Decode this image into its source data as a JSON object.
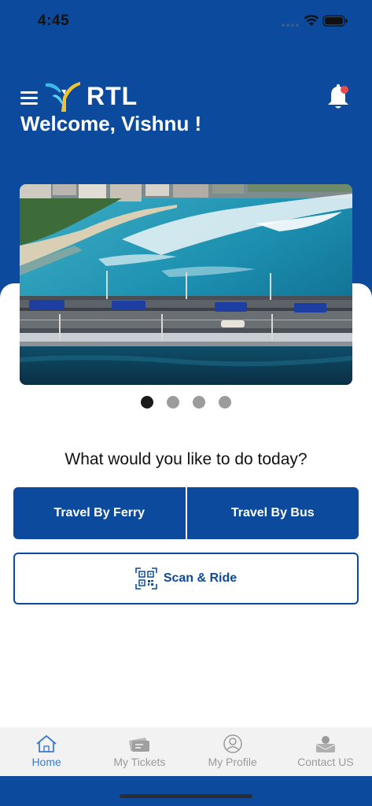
{
  "status_bar": {
    "time": "4:45"
  },
  "header": {
    "brand": "RTL",
    "welcome": "Welcome, Vishnu !"
  },
  "carousel": {
    "page_count": 4,
    "active_index": 0
  },
  "main": {
    "question": "What would you like to do today?",
    "ferry_label": "Travel By Ferry",
    "bus_label": "Travel By Bus",
    "scan_label": "Scan & Ride"
  },
  "tabs": [
    {
      "label": "Home",
      "icon": "home-icon",
      "active": true
    },
    {
      "label": "My Tickets",
      "icon": "tickets-icon",
      "active": false
    },
    {
      "label": "My Profile",
      "icon": "profile-icon",
      "active": false
    },
    {
      "label": "Contact US",
      "icon": "contact-icon",
      "active": false
    }
  ],
  "colors": {
    "brand_blue": "#0b4a9c",
    "active_tab": "#3d7ad6",
    "notification_dot": "#e94b4b"
  }
}
